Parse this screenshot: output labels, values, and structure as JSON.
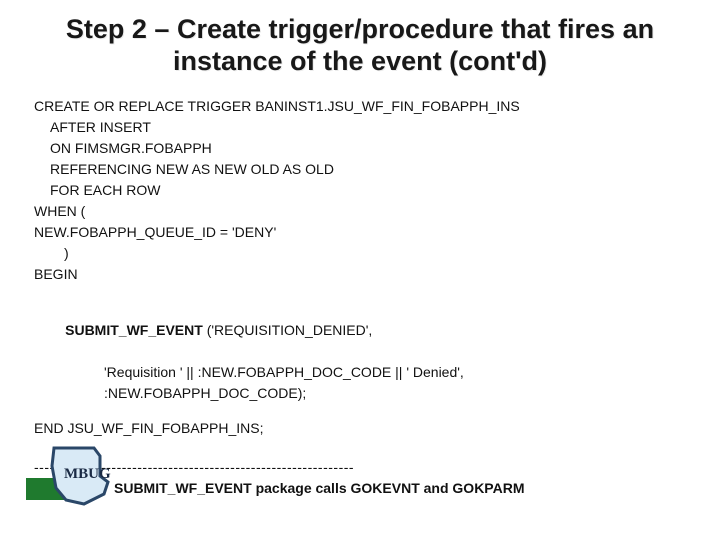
{
  "title": "Step 2 – Create trigger/procedure that fires an instance of the event (cont'd)",
  "code": {
    "l1": "CREATE OR REPLACE TRIGGER BANINST1.JSU_WF_FIN_FOBAPPH_INS",
    "l2": "AFTER INSERT",
    "l3": "ON FIMSMGR.FOBAPPH",
    "l4": "REFERENCING NEW AS NEW OLD AS OLD",
    "l5": "FOR EACH ROW",
    "l6": "WHEN (",
    "l7": "NEW.FOBAPPH_QUEUE_ID = 'DENY'",
    "l8": ")",
    "l9": "BEGIN",
    "call_bold": "SUBMIT_WF_EVENT",
    "call_rest": " ('REQUISITION_DENIED',",
    "arg2": "                  'Requisition ' || :NEW.FOBAPPH_DOC_CODE || ' Denied',",
    "arg3": "                  :NEW.FOBAPPH_DOC_CODE);",
    "end": "END JSU_WF_FIN_FOBAPPH_INS;",
    "divider": "--------------------------------------------------------------",
    "footer": "SUBMIT_WF_EVENT package calls GOKEVNT and GOKPARM"
  },
  "logo_text": "MBUG"
}
